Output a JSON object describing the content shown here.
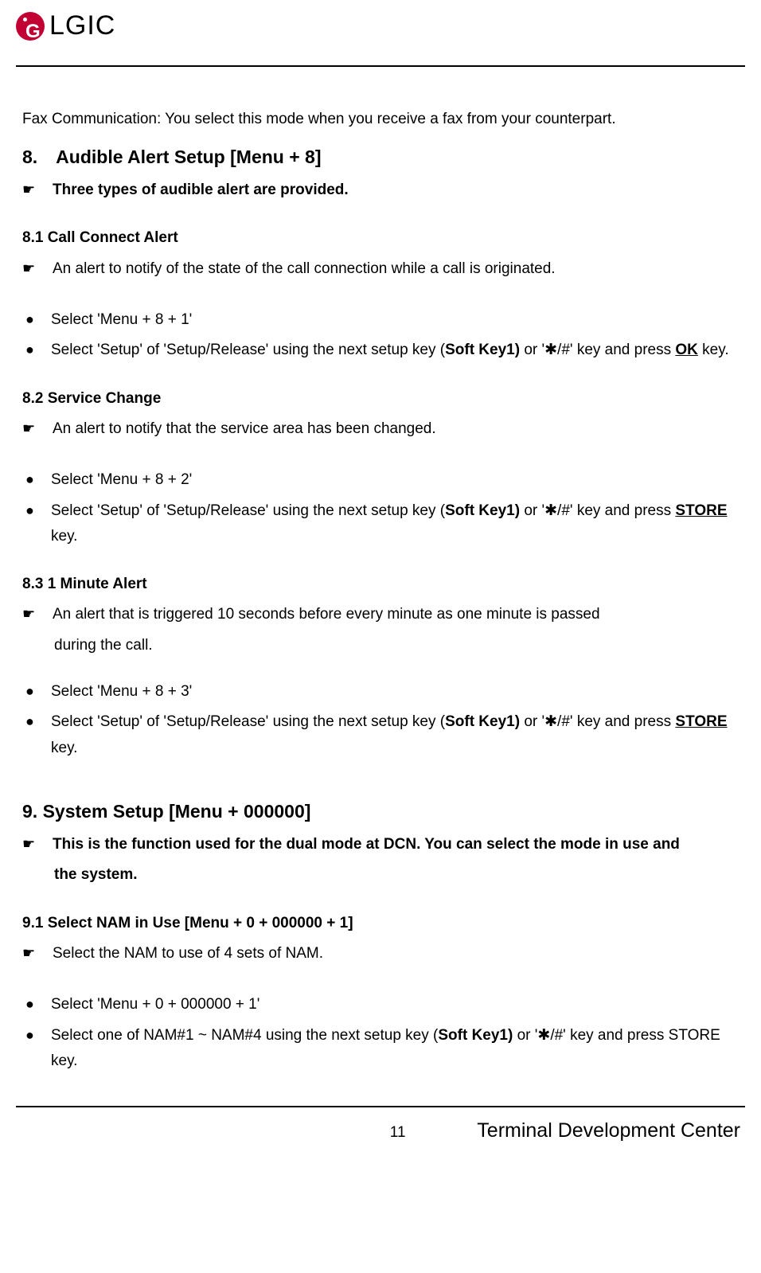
{
  "header": {
    "brand": "LGIC"
  },
  "fax_line": "Fax Communication: You select this mode when you receive a fax from your counterpart.",
  "s8": {
    "title": "8. Audible Alert Setup [Menu + 8]",
    "intro": "Three types of audible alert are provided.",
    "sub1": {
      "title": "8.1 Call Connect Alert",
      "desc": "An alert to notify of the state of the call connection while a call is originated.",
      "b1": "Select 'Menu + 8 + 1'",
      "b2_pre": "Select 'Setup' of 'Setup/Release' using the next setup key (",
      "b2_soft": "Soft Key1)",
      "b2_mid": " or '✱/#' key and press ",
      "b2_ok": "OK",
      "b2_post": " key."
    },
    "sub2": {
      "title": "8.2 Service Change",
      "desc": "An alert to notify that the service area has been changed.",
      "b1": "Select 'Menu + 8 + 2'",
      "b2_pre": "Select 'Setup' of 'Setup/Release' using the next setup key (",
      "b2_soft": "Soft Key1)",
      "b2_mid": " or '✱/#' key and press ",
      "b2_store": "STORE",
      "b2_post": " key."
    },
    "sub3": {
      "title": "8.3 1 Minute Alert",
      "desc1": "An alert that is triggered 10 seconds before every minute as one minute is passed",
      "desc2": "during the call.",
      "b1": "Select 'Menu + 8 + 3'",
      "b2_pre": "Select 'Setup' of 'Setup/Release' using the next setup key (",
      "b2_soft": "Soft Key1)",
      "b2_mid": " or '✱/#' key and press ",
      "b2_store": "STORE",
      "b2_post": " key."
    }
  },
  "s9": {
    "title": "9. System Setup [Menu + 000000]",
    "intro1": "This is the function used for the dual mode at DCN. You can select the mode in use and",
    "intro2": "the system.",
    "sub1": {
      "title": "9.1 Select NAM in Use [Menu + 0 + 000000 + 1]",
      "desc": "Select the NAM to use of 4 sets of NAM.",
      "b1": "Select 'Menu + 0 + 000000 + 1'",
      "b2_pre": "Select one of NAM#1 ~ NAM#4 using the next setup key (",
      "b2_soft": "Soft Key1)",
      "b2_mid": " or '✱/#' key and press STORE key."
    }
  },
  "footer": {
    "page": "11",
    "center": "Terminal Development Center"
  }
}
